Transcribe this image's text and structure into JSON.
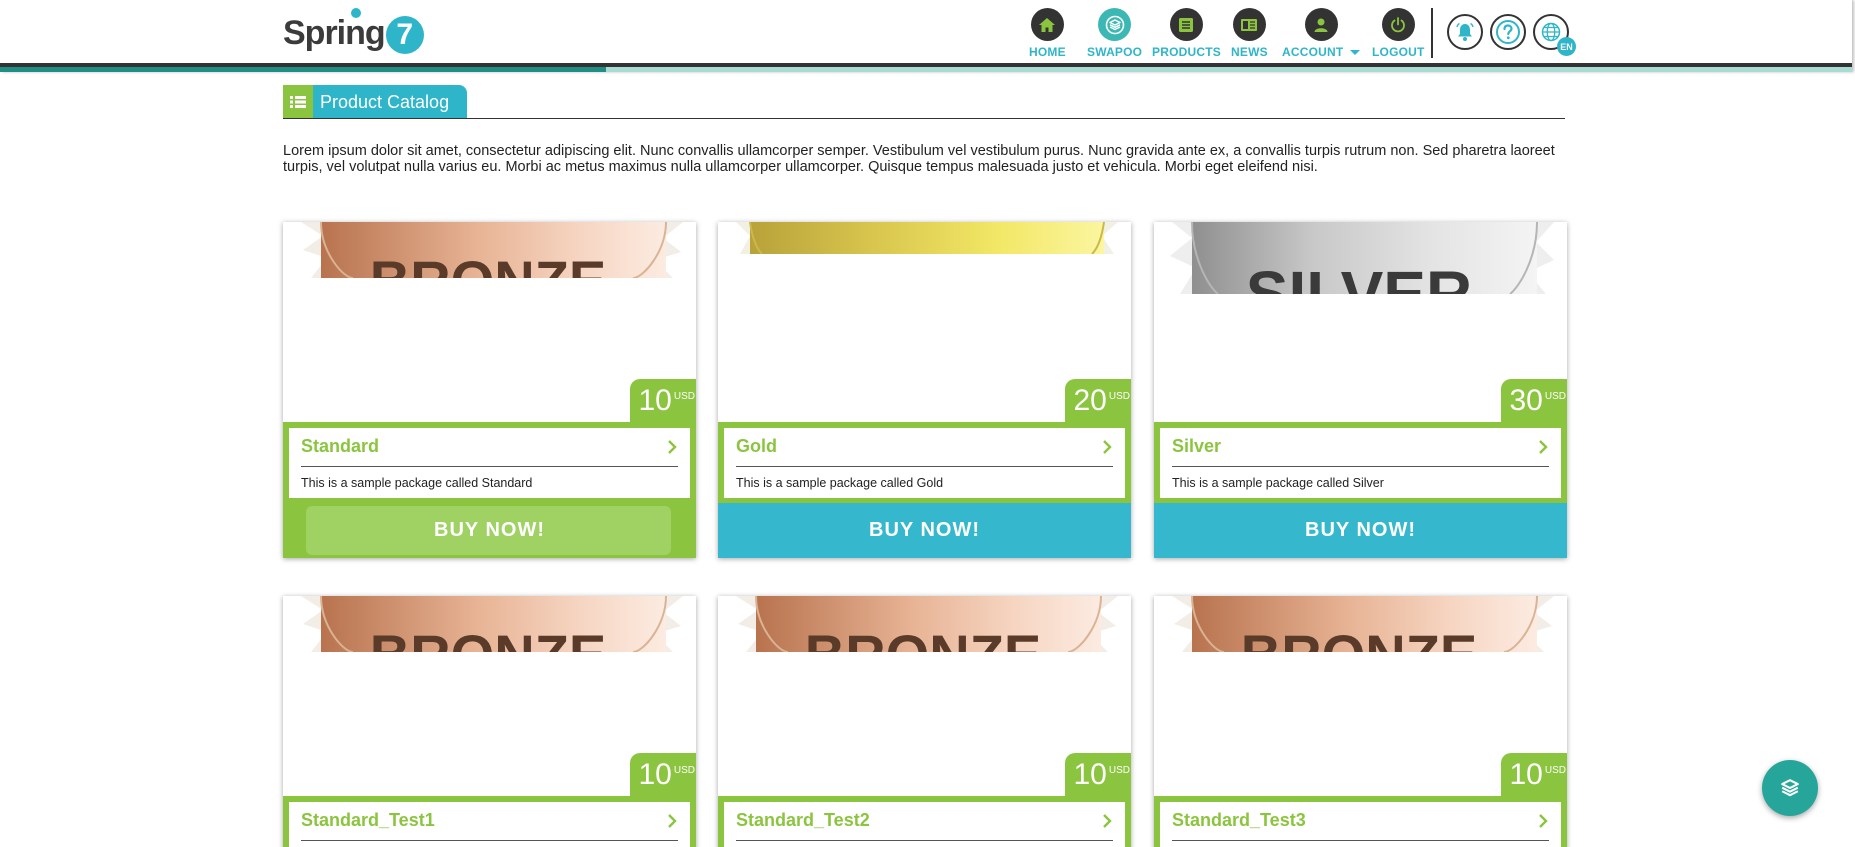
{
  "brand": {
    "name": "Spring",
    "mark": "7",
    "accent": "#2fb5c9",
    "green": "#8bc53f"
  },
  "nav": [
    {
      "label": "HOME",
      "icon": "home-icon"
    },
    {
      "label": "SWAPOO",
      "icon": "swapoo-icon",
      "active": true
    },
    {
      "label": "PRODUCTS",
      "icon": "products-icon"
    },
    {
      "label": "NEWS",
      "icon": "news-icon"
    },
    {
      "label": "ACCOUNT",
      "icon": "account-icon"
    },
    {
      "label": "LOGOUT",
      "icon": "power-icon"
    }
  ],
  "header_tools": {
    "notifications_icon": "bell-icon",
    "help_icon": "help-icon",
    "language_icon": "globe-icon",
    "language": "EN"
  },
  "progress": 0.327,
  "page": {
    "title": "Product Catalog",
    "intro": "Lorem ipsum dolor sit amet, consectetur adipiscing elit. Nunc convallis ullamcorper semper. Vestibulum vel vestibulum purus. Nunc gravida ante ex, a convallis turpis rutrum non. Sed pharetra laoreet turpis, vel volutpat nulla varius eu. Morbi ac metus maximus nulla ullamcorper ullamcorper. Quisque tempus malesuada justo et vehicula. Morbi eget eleifend nisi."
  },
  "products": [
    {
      "name": "Standard",
      "price": "10",
      "currency": "USD",
      "description": "This is a sample package called Standard",
      "buy_label": "BUY NOW!",
      "medal": "bronze",
      "medal_text": "BRONZE"
    },
    {
      "name": "Gold",
      "price": "20",
      "currency": "USD",
      "description": "This is a sample package called Gold",
      "buy_label": "BUY NOW!",
      "medal": "gold",
      "medal_text": ""
    },
    {
      "name": "Silver",
      "price": "30",
      "currency": "USD",
      "description": "This is a sample package called Silver",
      "buy_label": "BUY NOW!",
      "medal": "silver",
      "medal_text": "SILVER"
    },
    {
      "name": "Standard_Test1",
      "price": "10",
      "currency": "USD",
      "medal": "bronze",
      "medal_text": "BRONZE"
    },
    {
      "name": "Standard_Test2",
      "price": "10",
      "currency": "USD",
      "medal": "bronze",
      "medal_text": "BRONZE"
    },
    {
      "name": "Standard_Test3",
      "price": "10",
      "currency": "USD",
      "medal": "bronze",
      "medal_text": "BRONZE"
    }
  ],
  "fab": {
    "icon": "swapoo-icon"
  }
}
